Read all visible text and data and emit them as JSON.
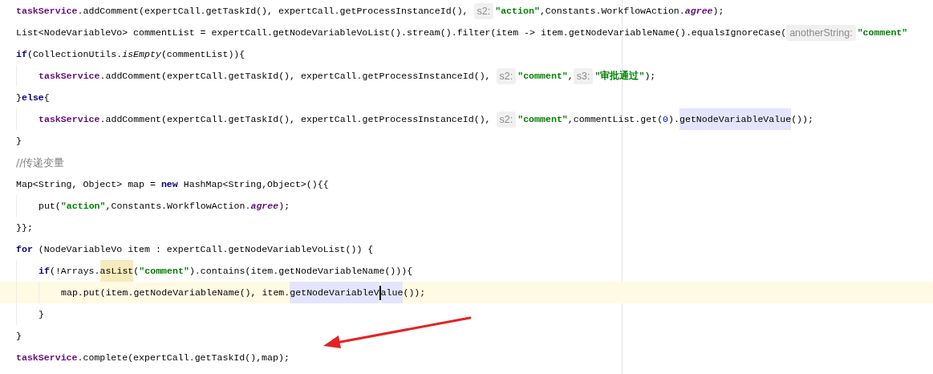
{
  "lines": [
    {
      "tokens": [
        {
          "kind": "field",
          "text": "taskService"
        },
        {
          "kind": "plain",
          "text": ".addComment(expertCall.getTaskId(), expertCall.getProcessInstanceId(), "
        },
        {
          "kind": "hint",
          "text": "s2:"
        },
        {
          "kind": "string",
          "text": "\"action\""
        },
        {
          "kind": "plain",
          "text": ",Constants.WorkflowAction."
        },
        {
          "kind": "static",
          "text": "agree"
        },
        {
          "kind": "plain",
          "text": ");"
        }
      ]
    },
    {
      "tokens": [
        {
          "kind": "plain",
          "text": "List<NodeVariableVo> commentList = expertCall.getNodeVariableVoList().stream().filter(item -> item.getNodeVariableName().equalsIgnoreCase("
        },
        {
          "kind": "hint",
          "text": "anotherString:"
        },
        {
          "kind": "string",
          "text": "\"comment\""
        }
      ]
    },
    {
      "tokens": [
        {
          "kind": "keyword",
          "text": "if"
        },
        {
          "kind": "plain",
          "text": "(CollectionUtils."
        },
        {
          "kind": "italic",
          "text": "isEmpty"
        },
        {
          "kind": "plain",
          "text": "(commentList)){"
        }
      ],
      "children": [
        {
          "tokens": [
            {
              "kind": "field",
              "text": "taskService"
            },
            {
              "kind": "plain",
              "text": ".addComment(expertCall.getTaskId(), expertCall.getProcessInstanceId(), "
            },
            {
              "kind": "hint",
              "text": "s2:"
            },
            {
              "kind": "string",
              "text": "\"comment\""
            },
            {
              "kind": "plain",
              "text": ","
            },
            {
              "kind": "hint",
              "text": "s3:"
            },
            {
              "kind": "string",
              "text": "\"审批通过\""
            },
            {
              "kind": "plain",
              "text": ");"
            }
          ]
        }
      ]
    },
    {
      "tokens": [
        {
          "kind": "plain",
          "text": "}"
        },
        {
          "kind": "keyword",
          "text": "else"
        },
        {
          "kind": "plain",
          "text": "{"
        }
      ],
      "children": [
        {
          "tokens": [
            {
              "kind": "field",
              "text": "taskService"
            },
            {
              "kind": "plain",
              "text": ".addComment(expertCall.getTaskId(), expertCall.getProcessInstanceId(), "
            },
            {
              "kind": "hint",
              "text": "s2:"
            },
            {
              "kind": "string",
              "text": "\"comment\""
            },
            {
              "kind": "plain",
              "text": ",commentList.get("
            },
            {
              "kind": "number",
              "text": "0"
            },
            {
              "kind": "plain",
              "text": ")."
            },
            {
              "kind": "usage",
              "text": "getNodeVariableValue"
            },
            {
              "kind": "plain",
              "text": "());"
            }
          ]
        }
      ]
    },
    {
      "tokens": [
        {
          "kind": "plain",
          "text": "}"
        }
      ]
    },
    {
      "tokens": [
        {
          "kind": "comment",
          "text": "//传递变量"
        }
      ]
    },
    {
      "tokens": [
        {
          "kind": "plain",
          "text": "Map<String, Object> map = "
        },
        {
          "kind": "keyword",
          "text": "new"
        },
        {
          "kind": "plain",
          "text": " HashMap<String,Object>(){{"
        }
      ],
      "children": [
        {
          "tokens": [
            {
              "kind": "plain",
              "text": "put("
            },
            {
              "kind": "string",
              "text": "\"action\""
            },
            {
              "kind": "plain",
              "text": ",Constants.WorkflowAction."
            },
            {
              "kind": "static",
              "text": "agree"
            },
            {
              "kind": "plain",
              "text": ");"
            }
          ]
        }
      ]
    },
    {
      "tokens": [
        {
          "kind": "plain",
          "text": "}};"
        }
      ]
    },
    {
      "tokens": [
        {
          "kind": "keyword",
          "text": "for"
        },
        {
          "kind": "plain",
          "text": " (NodeVariableVo item : expertCall.getNodeVariableVoList()) {"
        }
      ],
      "children": [
        {
          "tokens": [
            {
              "kind": "keyword",
              "text": "if"
            },
            {
              "kind": "plain",
              "text": "(!Arrays."
            },
            {
              "kind": "match",
              "text": "asList"
            },
            {
              "kind": "plain",
              "text": "("
            },
            {
              "kind": "string",
              "text": "\"comment\""
            },
            {
              "kind": "plain",
              "text": ").contains(item.getNodeVariableName())){"
            }
          ],
          "children": [
            {
              "current": true,
              "tokens": [
                {
                  "kind": "plain",
                  "text": "map.put(item.getNodeVariableName(), item."
                },
                {
                  "kind": "usage",
                  "text": "getNodeVariableV"
                },
                {
                  "kind": "caret"
                },
                {
                  "kind": "usage",
                  "text": "alue"
                },
                {
                  "kind": "plain",
                  "text": "());"
                }
              ]
            }
          ]
        },
        {
          "tokens": [
            {
              "kind": "plain",
              "text": "}"
            }
          ]
        }
      ]
    },
    {
      "tokens": [
        {
          "kind": "plain",
          "text": "}"
        }
      ]
    },
    {
      "tokens": [
        {
          "kind": "field",
          "text": "taskService"
        },
        {
          "kind": "plain",
          "text": ".complete(expertCall.getTaskId(),map);"
        }
      ]
    }
  ]
}
